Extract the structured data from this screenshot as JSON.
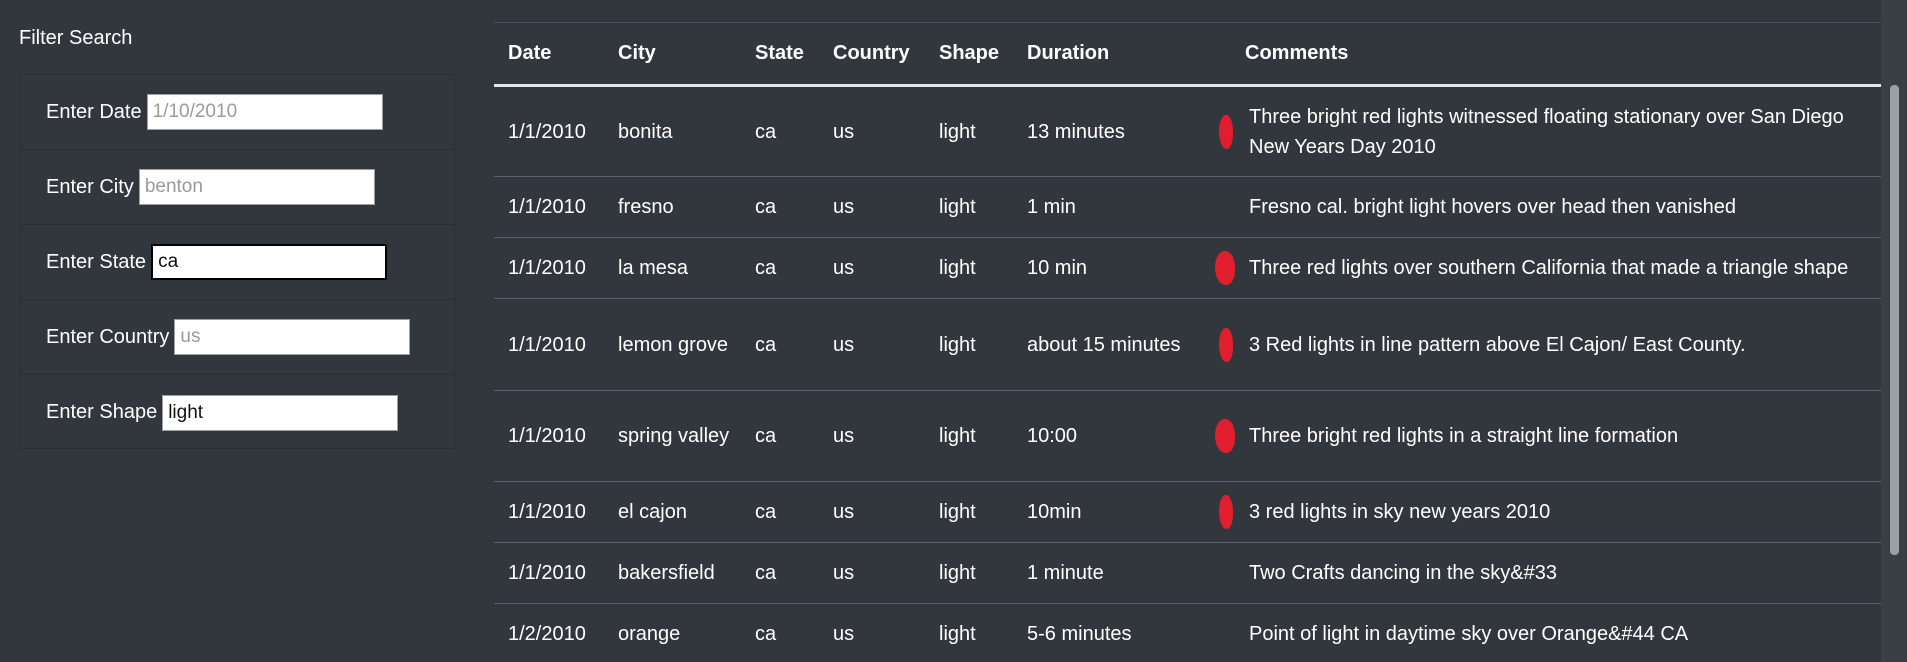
{
  "filter": {
    "title": "Filter Search",
    "fields": [
      {
        "label": "Enter Date",
        "placeholder": "1/10/2010",
        "value": ""
      },
      {
        "label": "Enter City",
        "placeholder": "benton",
        "value": ""
      },
      {
        "label": "Enter State",
        "placeholder": "",
        "value": "ca"
      },
      {
        "label": "Enter Country",
        "placeholder": "us",
        "value": ""
      },
      {
        "label": "Enter Shape",
        "placeholder": "",
        "value": "light"
      }
    ]
  },
  "table": {
    "headers": [
      "Date",
      "City",
      "State",
      "Country",
      "Shape",
      "Duration",
      "Comments"
    ],
    "rows": [
      [
        "1/1/2010",
        "bonita",
        "ca",
        "us",
        "light",
        "13 minutes",
        "Three bright red lights witnessed floating stationary over San Diego New Years Day 2010"
      ],
      [
        "1/1/2010",
        "fresno",
        "ca",
        "us",
        "light",
        "1 min",
        "Fresno cal. bright light hovers over head then vanished"
      ],
      [
        "1/1/2010",
        "la mesa",
        "ca",
        "us",
        "light",
        "10 min",
        "Three red lights over southern California that made a triangle shape"
      ],
      [
        "1/1/2010",
        "lemon grove",
        "ca",
        "us",
        "light",
        "about 15 minutes",
        "3 Red lights in line pattern above El Cajon/ East County."
      ],
      [
        "1/1/2010",
        "spring valley",
        "ca",
        "us",
        "light",
        "10:00",
        "Three bright red lights in a straight line formation"
      ],
      [
        "1/1/2010",
        "el cajon",
        "ca",
        "us",
        "light",
        "10min",
        "3 red lights in sky new years 2010"
      ],
      [
        "1/1/2010",
        "bakersfield",
        "ca",
        "us",
        "light",
        "1 minute",
        "Two Crafts dancing in the sky&#33"
      ],
      [
        "1/2/2010",
        "orange",
        "ca",
        "us",
        "light",
        "5-6 minutes",
        "Point of light in daytime sky over Orange&#44 CA"
      ]
    ]
  },
  "colors": {
    "background": "#32373d",
    "text": "#ffffff",
    "annotation_mark": "#e01e2d"
  }
}
